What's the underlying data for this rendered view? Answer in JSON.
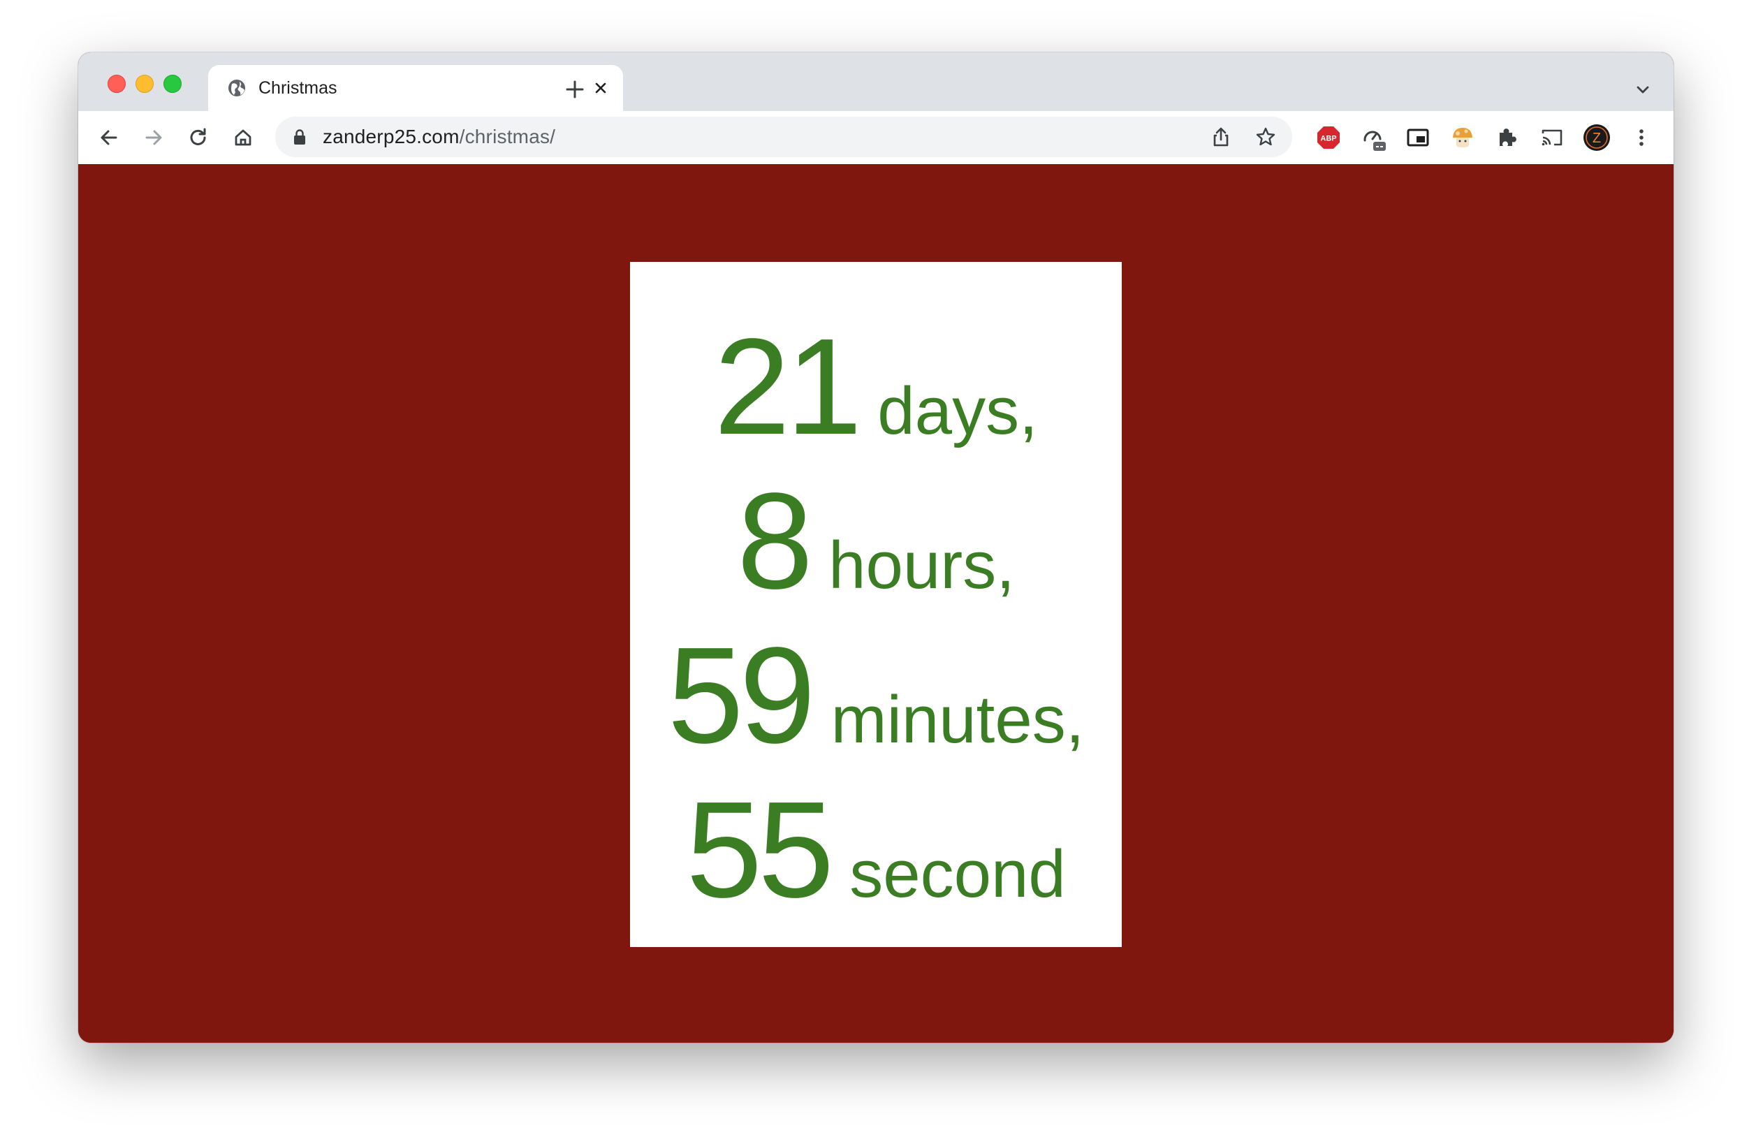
{
  "browser": {
    "tab": {
      "title": "Christmas"
    },
    "address_bar": {
      "host": "zanderp25.com",
      "path": "/christmas/"
    },
    "extensions": {
      "abp_label": "ABP"
    },
    "profile_initial": "Z"
  },
  "page": {
    "background_color": "#7f170f",
    "accent_color": "#3a7d22",
    "countdown": [
      {
        "value": "21",
        "unit": "days,"
      },
      {
        "value": "8",
        "unit": "hours,"
      },
      {
        "value": "59",
        "unit": "minutes,"
      },
      {
        "value": "55",
        "unit": "second"
      }
    ]
  }
}
